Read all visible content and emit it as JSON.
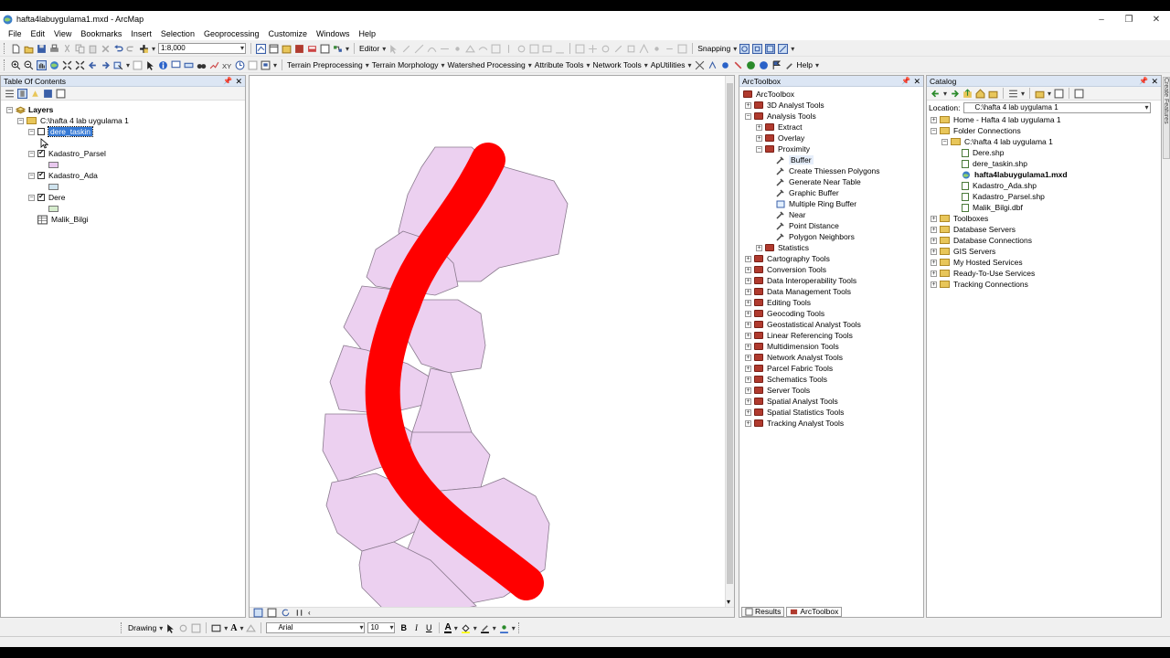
{
  "window": {
    "title": "hafta4labuygulama1.mxd - ArcMap",
    "min": "–",
    "max": "❐",
    "close": "✕"
  },
  "menu": [
    "File",
    "Edit",
    "View",
    "Bookmarks",
    "Insert",
    "Selection",
    "Geoprocessing",
    "Customize",
    "Windows",
    "Help"
  ],
  "toolbar1": {
    "scale": "1:8,000",
    "editor_label": "Editor",
    "snapping_label": "Snapping"
  },
  "toolbar2": {
    "menus": [
      "Terrain Preprocessing",
      "Terrain Morphology",
      "Watershed Processing",
      "Attribute Tools",
      "Network Tools",
      "ApUtilities"
    ],
    "help_label": "Help"
  },
  "toc": {
    "title": "Table Of Contents",
    "root": "Layers",
    "folder": "C:\\hafta 4 lab uygulama 1",
    "layers": [
      {
        "name": "dere_taskin",
        "checked": false,
        "selected": true
      },
      {
        "name": "Kadastro_Parsel",
        "checked": true,
        "color": "#e8c8ee"
      },
      {
        "name": "Kadastro_Ada",
        "checked": true,
        "color": "#cfe3ee"
      },
      {
        "name": "Dere",
        "checked": true,
        "color": "#d6eccd"
      }
    ],
    "table": "Malik_Bilgi"
  },
  "toolbox": {
    "title": "ArcToolbox",
    "root": "ArcToolbox",
    "items": [
      {
        "label": "3D Analyst Tools",
        "level": 0,
        "kind": "box",
        "exp": "+"
      },
      {
        "label": "Analysis Tools",
        "level": 0,
        "kind": "box",
        "exp": "−"
      },
      {
        "label": "Extract",
        "level": 1,
        "kind": "box",
        "exp": "+"
      },
      {
        "label": "Overlay",
        "level": 1,
        "kind": "box",
        "exp": "+"
      },
      {
        "label": "Proximity",
        "level": 1,
        "kind": "box",
        "exp": "−"
      },
      {
        "label": "Buffer",
        "level": 2,
        "kind": "tool",
        "hl": true
      },
      {
        "label": "Create Thiessen Polygons",
        "level": 2,
        "kind": "tool"
      },
      {
        "label": "Generate Near Table",
        "level": 2,
        "kind": "tool"
      },
      {
        "label": "Graphic Buffer",
        "level": 2,
        "kind": "tool"
      },
      {
        "label": "Multiple Ring Buffer",
        "level": 2,
        "kind": "script"
      },
      {
        "label": "Near",
        "level": 2,
        "kind": "tool"
      },
      {
        "label": "Point Distance",
        "level": 2,
        "kind": "tool"
      },
      {
        "label": "Polygon Neighbors",
        "level": 2,
        "kind": "tool"
      },
      {
        "label": "Statistics",
        "level": 1,
        "kind": "box",
        "exp": "+"
      },
      {
        "label": "Cartography Tools",
        "level": 0,
        "kind": "box",
        "exp": "+"
      },
      {
        "label": "Conversion Tools",
        "level": 0,
        "kind": "box",
        "exp": "+"
      },
      {
        "label": "Data Interoperability Tools",
        "level": 0,
        "kind": "box",
        "exp": "+"
      },
      {
        "label": "Data Management Tools",
        "level": 0,
        "kind": "box",
        "exp": "+"
      },
      {
        "label": "Editing Tools",
        "level": 0,
        "kind": "box",
        "exp": "+"
      },
      {
        "label": "Geocoding Tools",
        "level": 0,
        "kind": "box",
        "exp": "+"
      },
      {
        "label": "Geostatistical Analyst Tools",
        "level": 0,
        "kind": "box",
        "exp": "+"
      },
      {
        "label": "Linear Referencing Tools",
        "level": 0,
        "kind": "box",
        "exp": "+"
      },
      {
        "label": "Multidimension Tools",
        "level": 0,
        "kind": "box",
        "exp": "+"
      },
      {
        "label": "Network Analyst Tools",
        "level": 0,
        "kind": "box",
        "exp": "+"
      },
      {
        "label": "Parcel Fabric Tools",
        "level": 0,
        "kind": "box",
        "exp": "+"
      },
      {
        "label": "Schematics Tools",
        "level": 0,
        "kind": "box",
        "exp": "+"
      },
      {
        "label": "Server Tools",
        "level": 0,
        "kind": "box",
        "exp": "+"
      },
      {
        "label": "Spatial Analyst Tools",
        "level": 0,
        "kind": "box",
        "exp": "+"
      },
      {
        "label": "Spatial Statistics Tools",
        "level": 0,
        "kind": "box",
        "exp": "+"
      },
      {
        "label": "Tracking Analyst Tools",
        "level": 0,
        "kind": "box",
        "exp": "+"
      }
    ],
    "tabs": [
      "Results",
      "ArcToolbox"
    ]
  },
  "catalog": {
    "title": "Catalog",
    "location_label": "Location:",
    "location_value": "C:\\hafta 4 lab uygulama 1",
    "items": [
      {
        "label": "Home - Hafta 4 lab uygulama 1",
        "level": 0,
        "kind": "folder",
        "exp": "+"
      },
      {
        "label": "Folder Connections",
        "level": 0,
        "kind": "folder",
        "exp": "−"
      },
      {
        "label": "C:\\hafta 4 lab uygulama 1",
        "level": 1,
        "kind": "folder",
        "exp": "−"
      },
      {
        "label": "Dere.shp",
        "level": 2,
        "kind": "file"
      },
      {
        "label": "dere_taskin.shp",
        "level": 2,
        "kind": "file"
      },
      {
        "label": "hafta4labuygulama1.mxd",
        "level": 2,
        "kind": "mxd",
        "bold": true
      },
      {
        "label": "Kadastro_Ada.shp",
        "level": 2,
        "kind": "file"
      },
      {
        "label": "Kadastro_Parsel.shp",
        "level": 2,
        "kind": "file"
      },
      {
        "label": "Malik_Bilgi.dbf",
        "level": 2,
        "kind": "file"
      },
      {
        "label": "Toolboxes",
        "level": 0,
        "kind": "folder",
        "exp": "+"
      },
      {
        "label": "Database Servers",
        "level": 0,
        "kind": "folder",
        "exp": "+"
      },
      {
        "label": "Database Connections",
        "level": 0,
        "kind": "folder",
        "exp": "+"
      },
      {
        "label": "GIS Servers",
        "level": 0,
        "kind": "folder",
        "exp": "+"
      },
      {
        "label": "My Hosted Services",
        "level": 0,
        "kind": "folder",
        "exp": "+"
      },
      {
        "label": "Ready-To-Use Services",
        "level": 0,
        "kind": "folder",
        "exp": "+"
      },
      {
        "label": "Tracking Connections",
        "level": 0,
        "kind": "folder",
        "exp": "+"
      }
    ],
    "side_tab": "Create Features"
  },
  "drawing": {
    "label": "Drawing",
    "font": "Arial",
    "size": "10",
    "bold": "B",
    "italic": "I",
    "underline": "U",
    "fontcolor": "A"
  },
  "map": {
    "parcel_fill": "#ecd0f0",
    "parcel_stroke": "#8a7a8e",
    "river_color": "#ff0000"
  }
}
